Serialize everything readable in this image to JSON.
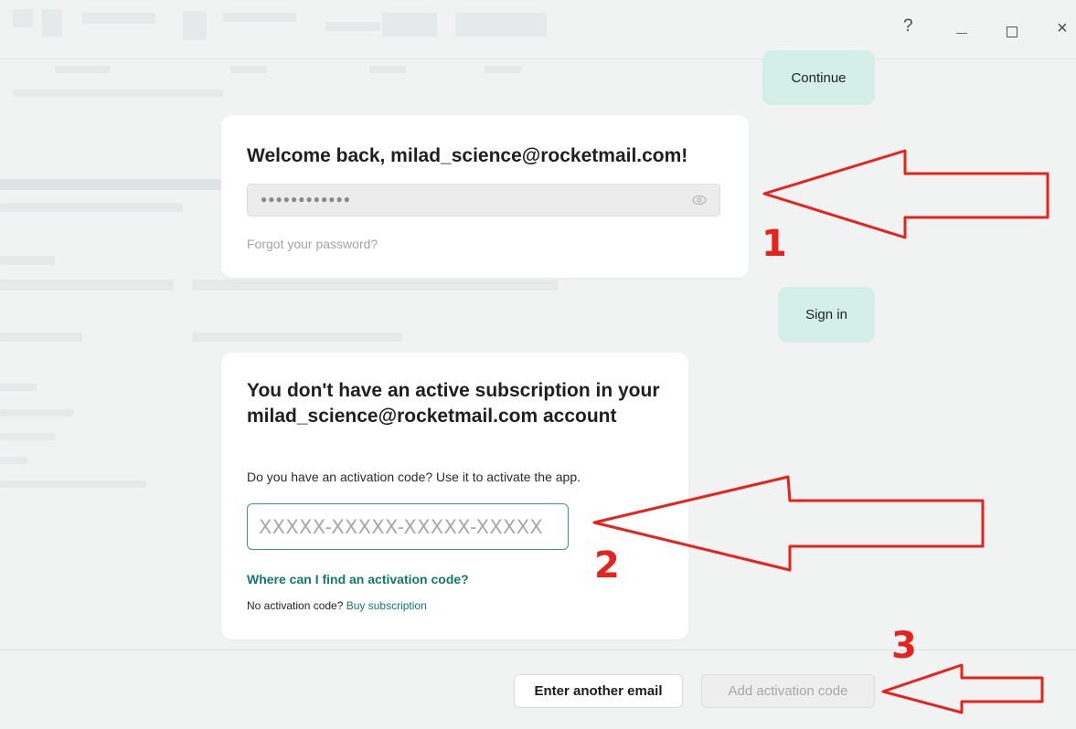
{
  "window_controls": {
    "help": "?",
    "close": "×"
  },
  "background_buttons": {
    "continue_label": "Continue",
    "signin_label": "Sign in"
  },
  "login_card": {
    "title": "Welcome back, milad_science@rocketmail.com!",
    "password_masked": "●●●●●●●●●●●●",
    "forgot_link": "Forgot your password?"
  },
  "activation_card": {
    "title": "You don't have an active subscription in your milad_science@rocketmail.com account",
    "subtitle": "Do you have an activation code? Use it to activate the app.",
    "code_placeholder": "XXXXX-XXXXX-XXXXX-XXXXX",
    "where_link": "Where can I find an activation code?",
    "no_code_text": "No activation code? ",
    "buy_link": "Buy subscription"
  },
  "footer": {
    "enter_another_email": "Enter another email",
    "add_activation_code": "Add activation code"
  },
  "annotations": {
    "label_1": "1",
    "label_2": "2",
    "label_3": "3",
    "arrow_color": "#e8211d"
  },
  "colors": {
    "accent_teal": "#0f7a6c",
    "mint_button": "#d3efe8",
    "input_border": "#3f9688"
  }
}
